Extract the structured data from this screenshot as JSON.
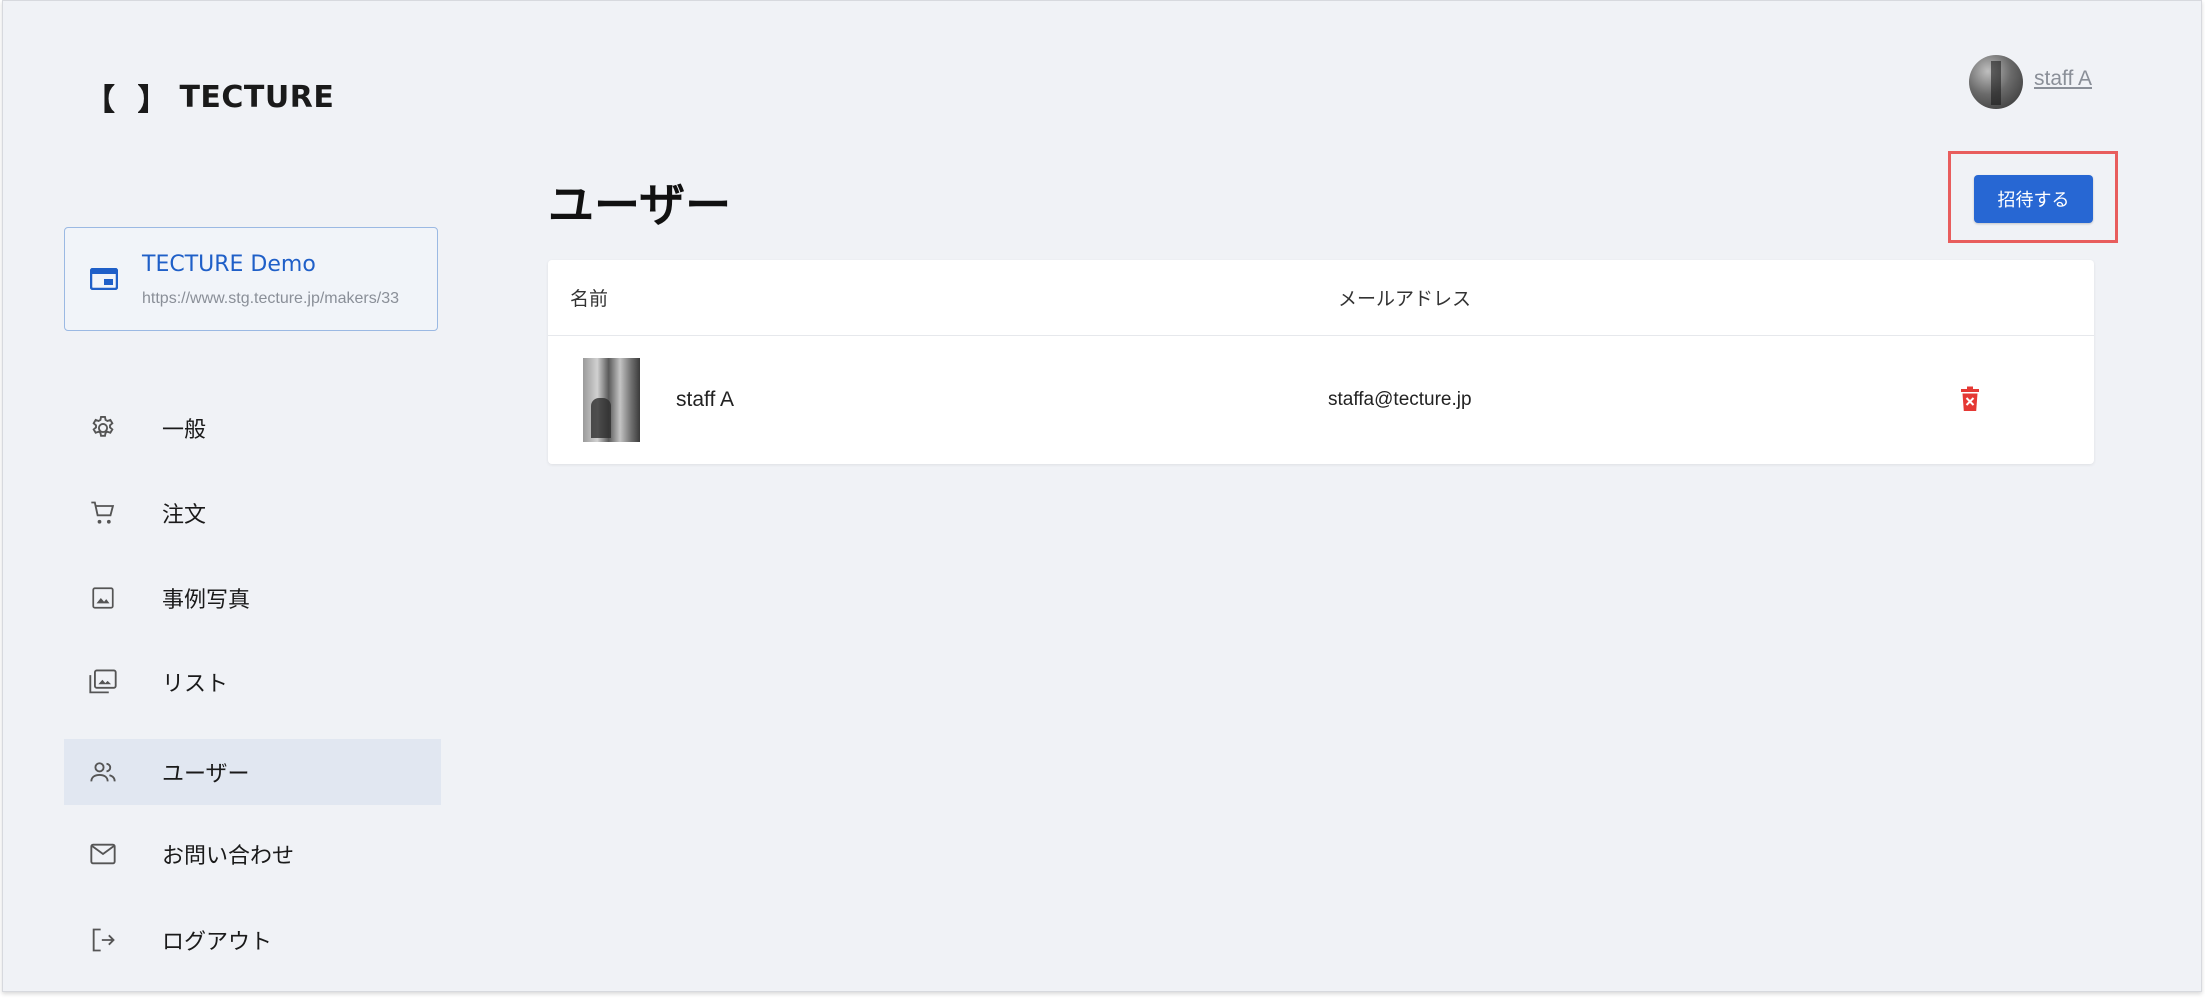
{
  "brand": {
    "brackets": "【 】",
    "name": "TECTURE"
  },
  "header": {
    "user_name": "staff A"
  },
  "maker": {
    "name": "TECTURE Demo",
    "url": "https://www.stg.tecture.jp/makers/33"
  },
  "sidebar": {
    "items": [
      {
        "label": "一般",
        "icon": "gear-icon",
        "active": false
      },
      {
        "label": "注文",
        "icon": "cart-icon",
        "active": false
      },
      {
        "label": "事例写真",
        "icon": "image-icon",
        "active": false
      },
      {
        "label": "リスト",
        "icon": "photo-library-icon",
        "active": false
      },
      {
        "label": "ユーザー",
        "icon": "people-icon",
        "active": true
      },
      {
        "label": "お問い合わせ",
        "icon": "mail-icon",
        "active": false
      },
      {
        "label": "ログアウト",
        "icon": "logout-icon",
        "active": false
      }
    ]
  },
  "main": {
    "title": "ユーザー",
    "invite_label": "招待する",
    "table": {
      "columns": [
        "名前",
        "メールアドレス"
      ],
      "rows": [
        {
          "name": "staff A",
          "email": "staffa@tecture.jp"
        }
      ]
    }
  },
  "colors": {
    "accent": "#2767d3",
    "highlight": "#e85d5d",
    "delete": "#e53935",
    "background": "#f0f2f6"
  }
}
